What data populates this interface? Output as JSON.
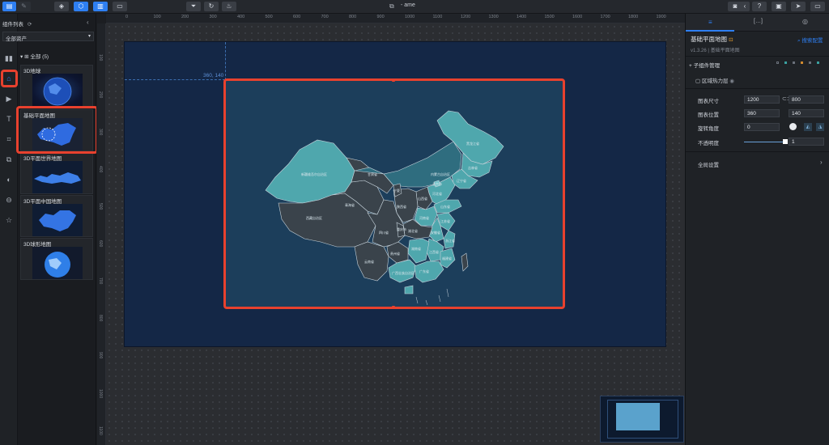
{
  "topbar": {
    "title": "- ame"
  },
  "asset_panel": {
    "header": "组件列表",
    "dropdown": "全部资产",
    "group_label": "全部 (5)",
    "items": [
      {
        "label": "3D地球"
      },
      {
        "label": "基础平面地图"
      },
      {
        "label": "3D平面世界地图"
      },
      {
        "label": "3D平面中国地图"
      },
      {
        "label": "3D球形地图"
      }
    ]
  },
  "ruler": {
    "ticks": [
      "0",
      "100",
      "200",
      "300",
      "400",
      "500",
      "600",
      "700",
      "800",
      "900",
      "1000",
      "1100",
      "1200",
      "1300",
      "1400",
      "1500",
      "1600",
      "1700",
      "1800",
      "1900"
    ],
    "left_ticks": [
      "100",
      "200",
      "300",
      "400",
      "500",
      "600",
      "700",
      "800",
      "900",
      "1000",
      "1100"
    ]
  },
  "canvas": {
    "position_label": "360, 140"
  },
  "map_labels": [
    "新疆维吾尔自治区",
    "西藏自治区",
    "青海省",
    "甘肃省",
    "内蒙古自治区",
    "黑龙江省",
    "吉林省",
    "辽宁省",
    "四川省",
    "云南省",
    "广西壮族自治区",
    "广东省",
    "湖南省",
    "湖北省",
    "河南省",
    "山东省",
    "江苏省",
    "浙江省",
    "福建省",
    "江西省",
    "安徽省",
    "陕西省",
    "山西省",
    "河北省",
    "贵州省",
    "重庆市",
    "宁夏",
    "北京市"
  ],
  "right_panel": {
    "tabs": [
      "≡",
      "[…]",
      "◎"
    ],
    "component_title": "基础平面地图",
    "search_config": "搜索配置",
    "version": "v1.3.26 | 基础平面地图",
    "subcomponent_title": "+ 子组件管理",
    "sub_item": "区域热力层",
    "fields": [
      {
        "label": "图表尺寸",
        "v1": "1200",
        "v2": "800"
      },
      {
        "label": "图表位置",
        "v1": "360",
        "v2": "140"
      },
      {
        "label": "旋转角度",
        "v1": "0"
      },
      {
        "label": "不透明度",
        "v1": "1"
      }
    ],
    "global_settings": "全局设置"
  },
  "colors": {
    "accent": "#2e7ff2",
    "highlight_red": "#e8412e",
    "map_teal": "#4fa7ad",
    "map_dark": "#3a434b",
    "artboard": "#142746"
  }
}
